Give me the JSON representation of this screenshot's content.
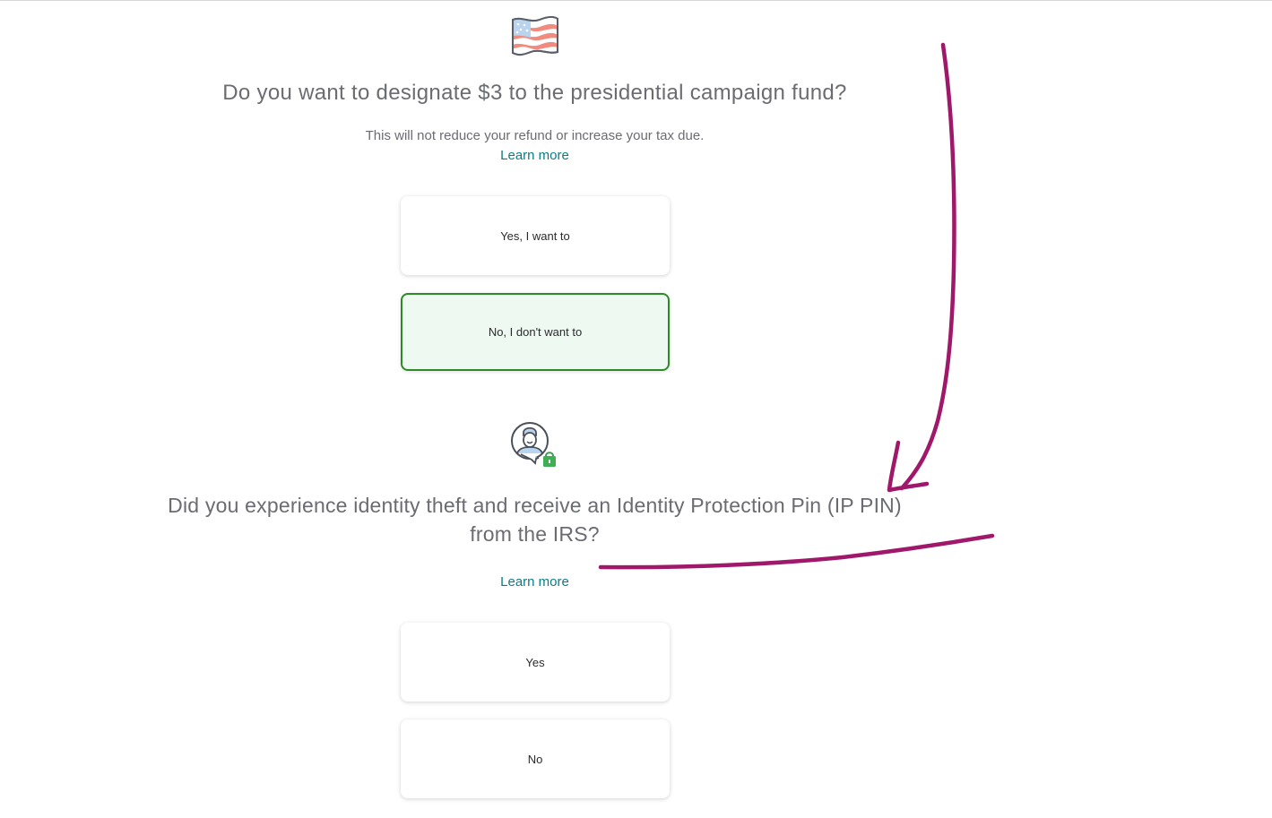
{
  "campaign_fund": {
    "icon": "american-flag-icon",
    "title": "Do you want to designate $3 to the presidential campaign fund?",
    "subtitle": "This will not reduce your refund or increase your tax due.",
    "learn_more": "Learn more",
    "options": [
      {
        "label": "Yes, I want to",
        "selected": false
      },
      {
        "label": "No, I don't want to",
        "selected": true
      }
    ]
  },
  "ip_pin": {
    "icon": "identity-lock-icon",
    "title_line1": "Did you experience identity theft and receive an Identity Protection Pin (IP PIN)",
    "title_line2": "from the IRS?",
    "learn_more": "Learn more",
    "options": [
      {
        "label": "Yes",
        "selected": false
      },
      {
        "label": "No",
        "selected": false
      }
    ]
  },
  "colors": {
    "accent_link": "#0d7d84",
    "selected_border": "#2c8a27",
    "selected_bg": "#eef9f1",
    "annotation_ink": "#a0186a"
  }
}
